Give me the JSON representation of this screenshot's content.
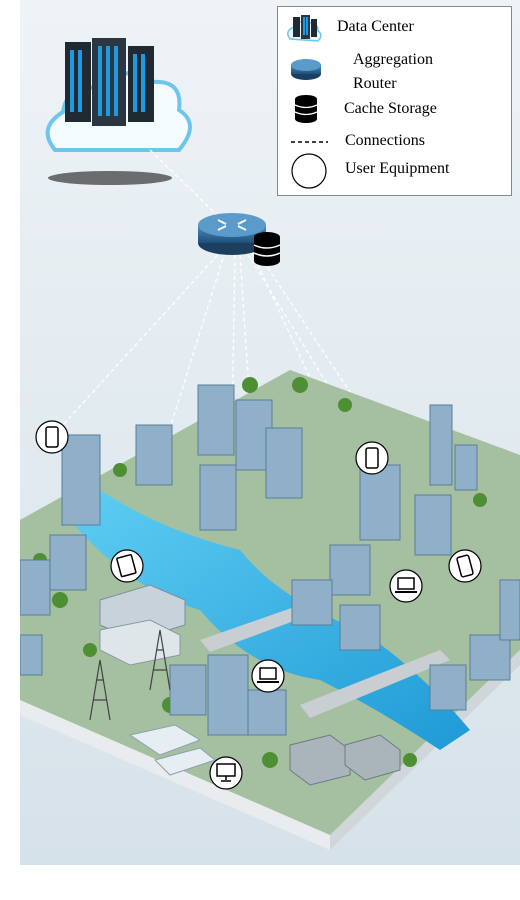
{
  "legend": {
    "items": [
      {
        "label": "Data Center",
        "icon": "data-center-icon"
      },
      {
        "label_line1": "Aggregation",
        "label_line2": "Router",
        "icon": "router-icon"
      },
      {
        "label": "Cache Storage",
        "icon": "database-icon"
      },
      {
        "label": "Connections",
        "icon": "dashed-line-icon"
      },
      {
        "label": "User Equipment",
        "icon": "circle-icon"
      }
    ]
  },
  "devices": [
    {
      "type": "phone-icon"
    },
    {
      "type": "tablet-icon"
    },
    {
      "type": "phone-icon"
    },
    {
      "type": "phone-icon"
    },
    {
      "type": "laptop-icon"
    },
    {
      "type": "laptop-icon"
    },
    {
      "type": "monitor-icon"
    }
  ],
  "colors": {
    "sky": "#dfe8ee",
    "river": "#3fb6e6",
    "grass": "#6fb04a",
    "router": "#2f6f9f",
    "server_accent": "#1e9be0"
  }
}
